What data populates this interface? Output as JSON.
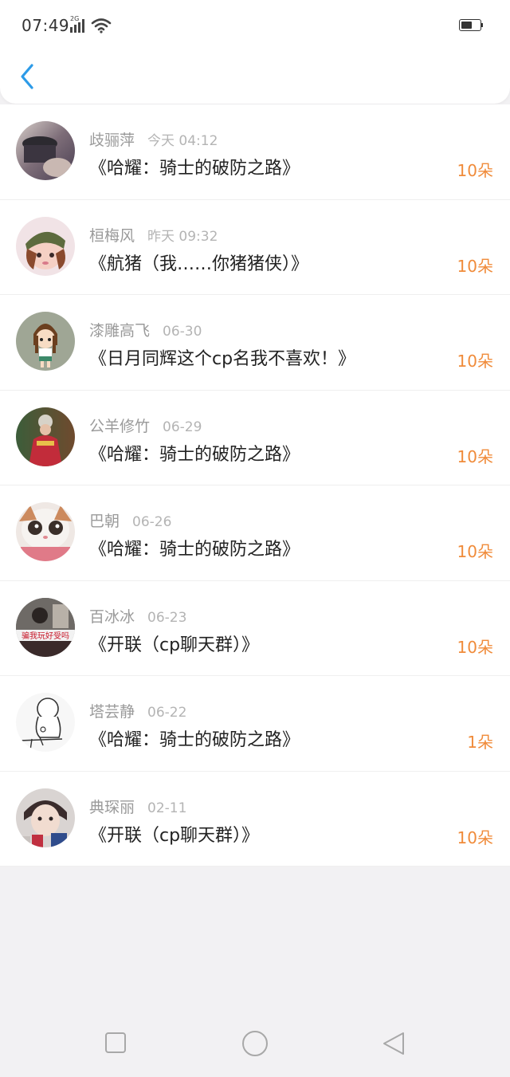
{
  "status_bar": {
    "time": "07:49",
    "network_label": "2G",
    "icons": [
      "signal-icon",
      "wifi-icon",
      "battery-icon"
    ]
  },
  "header": {
    "back_icon": "chevron-left-icon"
  },
  "colors": {
    "accent": "#2d9be8",
    "flower_count": "#f08b3a",
    "sender": "#9a9a9a",
    "time": "#b4b4b4",
    "title": "#222222",
    "background": "#f2f1f3"
  },
  "records": [
    {
      "sender": "歧骊萍",
      "time": "今天 04:12",
      "title": "《哈耀：骑士的破防之路》",
      "flowers": "10朵"
    },
    {
      "sender": "桓梅风",
      "time": "昨天 09:32",
      "title": "《航猪（我……你猪猪侠）》",
      "flowers": "10朵"
    },
    {
      "sender": "漆雕高飞",
      "time": "06-30",
      "title": "《日月同辉这个cp名我不喜欢！》",
      "flowers": "10朵"
    },
    {
      "sender": "公羊修竹",
      "time": "06-29",
      "title": "《哈耀：骑士的破防之路》",
      "flowers": "10朵"
    },
    {
      "sender": "巴朝",
      "time": "06-26",
      "title": "《哈耀：骑士的破防之路》",
      "flowers": "10朵"
    },
    {
      "sender": "百冰冰",
      "time": "06-23",
      "title": "《开联（cp聊天群）》",
      "flowers": "10朵",
      "avatar_text": "骗我玩好受吗"
    },
    {
      "sender": "塔芸静",
      "time": "06-22",
      "title": "《哈耀：骑士的破防之路》",
      "flowers": "1朵"
    },
    {
      "sender": "典琛丽",
      "time": "02-11",
      "title": "《开联（cp聊天群）》",
      "flowers": "10朵"
    }
  ],
  "bottom_nav": {
    "icons": [
      "recent-apps-icon",
      "home-icon",
      "back-icon"
    ]
  }
}
